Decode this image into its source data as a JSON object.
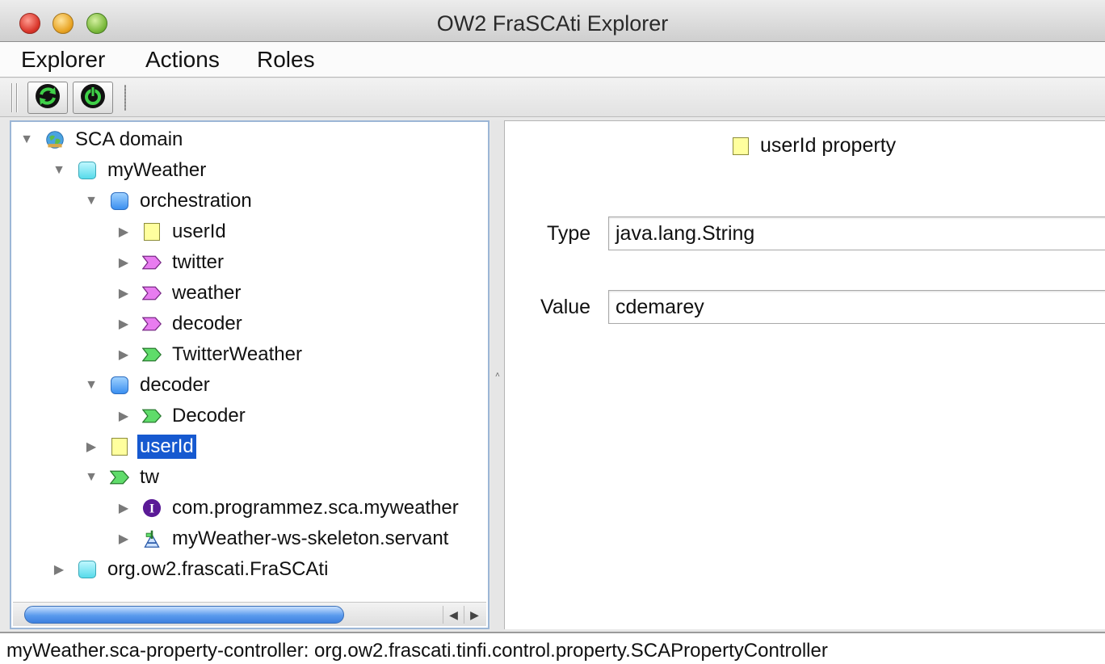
{
  "window": {
    "title": "OW2 FraSCAti Explorer"
  },
  "menu": {
    "items": [
      "Explorer",
      "Actions",
      "Roles"
    ]
  },
  "toolbar": {
    "buttons": [
      "refresh-icon",
      "power-icon"
    ]
  },
  "tree": {
    "root": "SCA domain",
    "myweather": "myWeather",
    "orchestration": "orchestration",
    "orch_userid": "userId",
    "twitter": "twitter",
    "weather": "weather",
    "orch_decoder": "decoder",
    "twitterweather": "TwitterWeather",
    "decoder": "decoder",
    "decoder_service": "Decoder",
    "userid_selected": "userId",
    "tw": "tw",
    "interface": "com.programmez.sca.myweather",
    "servant": "myWeather-ws-skeleton.servant",
    "frascati": "org.ow2.frascati.FraSCAti"
  },
  "detail": {
    "title": "userId property",
    "type_label": "Type",
    "type_value": "java.lang.String",
    "value_label": "Value",
    "value_value": "cdemarey"
  },
  "status": {
    "text": "myWeather.sca-property-controller: org.ow2.frascati.tinfi.control.property.SCAPropertyController"
  },
  "colors": {
    "selection": "#1659d0",
    "service_green": "#5fdc6a",
    "reference_magenta": "#e87cf0",
    "property_yellow": "#ffff9e",
    "interface_purple": "#5a1a96"
  }
}
